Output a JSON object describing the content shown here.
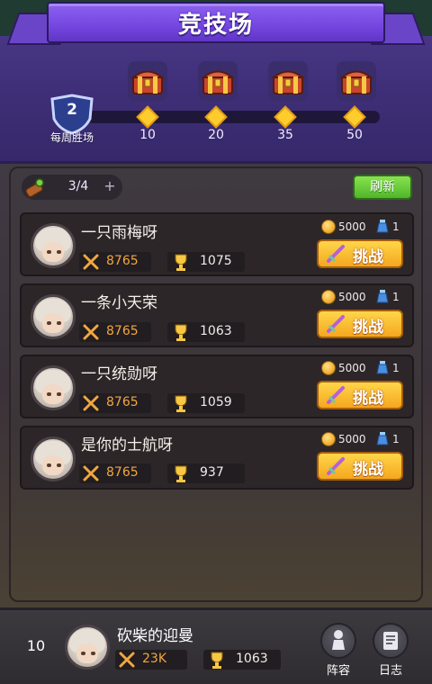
{
  "header": {
    "title": "竞技场",
    "weekly_wins": {
      "count": "2",
      "label": "每周胜场"
    },
    "milestones": [
      {
        "value": "10",
        "icon": "treasure-chest"
      },
      {
        "value": "20",
        "icon": "treasure-chest"
      },
      {
        "value": "35",
        "icon": "treasure-chest"
      },
      {
        "value": "50",
        "icon": "treasure-chest"
      }
    ]
  },
  "tickets": {
    "count": "3/4",
    "add_label": "+",
    "icon": "ticket-potion"
  },
  "refresh_label": "刷新",
  "opponents": [
    {
      "name": "一只雨梅呀",
      "power": "8765",
      "trophies": "1075",
      "reward_gold": "5000",
      "reward_potion": "1",
      "challenge_label": "挑战"
    },
    {
      "name": "一条小天荣",
      "power": "8765",
      "trophies": "1063",
      "reward_gold": "5000",
      "reward_potion": "1",
      "challenge_label": "挑战"
    },
    {
      "name": "一只统勋呀",
      "power": "8765",
      "trophies": "1059",
      "reward_gold": "5000",
      "reward_potion": "1",
      "challenge_label": "挑战"
    },
    {
      "name": "是你的士航呀",
      "power": "8765",
      "trophies": "937",
      "reward_gold": "5000",
      "reward_potion": "1",
      "challenge_label": "挑战"
    }
  ],
  "player": {
    "rank": "10",
    "name": "砍柴的迎曼",
    "power": "23K",
    "trophies": "1063"
  },
  "nav": [
    {
      "label": "阵容",
      "icon": "chess-piece-icon"
    },
    {
      "label": "日志",
      "icon": "log-book-icon"
    }
  ],
  "colors": {
    "header_purple": "#4f3b8e",
    "banner_purple": "#7446e0",
    "milestone_gold": "#ffcc2e",
    "challenge_orange": "#f5a71f",
    "refresh_green": "#4fb52a",
    "power_orange": "#f0a741"
  }
}
